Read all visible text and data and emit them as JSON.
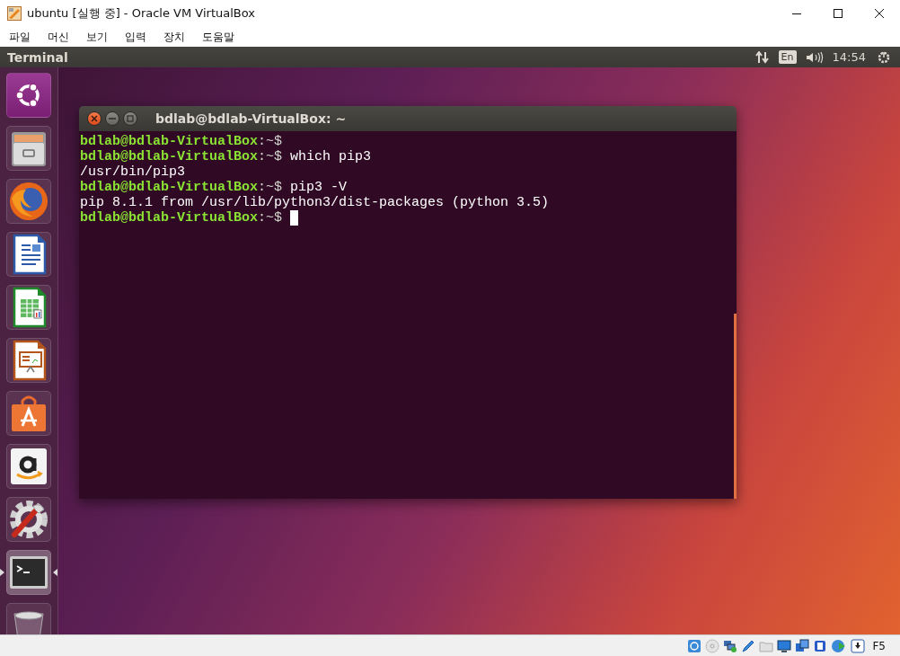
{
  "host_window": {
    "title": "ubuntu [실행 중] - Oracle VM VirtualBox"
  },
  "menu_bar": [
    "파일",
    "머신",
    "보기",
    "입력",
    "장치",
    "도움말"
  ],
  "top_panel": {
    "app_title": "Terminal",
    "keyboard_layout": "En",
    "clock": "14:54"
  },
  "launcher": [
    {
      "kind": "dash",
      "running": false,
      "focused": false
    },
    {
      "kind": "files",
      "running": false,
      "focused": false
    },
    {
      "kind": "browser",
      "running": false,
      "focused": false
    },
    {
      "kind": "writer",
      "running": false,
      "focused": false
    },
    {
      "kind": "calc",
      "running": false,
      "focused": false
    },
    {
      "kind": "impress",
      "running": false,
      "focused": false
    },
    {
      "kind": "software",
      "running": false,
      "focused": false
    },
    {
      "kind": "store",
      "running": false,
      "focused": false
    },
    {
      "kind": "settings",
      "running": false,
      "focused": false
    },
    {
      "kind": "terminal",
      "running": true,
      "focused": true
    },
    {
      "kind": "trash",
      "running": false,
      "focused": false
    }
  ],
  "terminal": {
    "title": "bdlab@bdlab-VirtualBox: ~",
    "lines": [
      {
        "kind": "prompt",
        "user_host": "bdlab@bdlab-VirtualBox",
        "path": ":~$",
        "cursor": false
      },
      {
        "kind": "prompt",
        "user_host": "bdlab@bdlab-VirtualBox",
        "path": ":~$",
        "command": "which pip3",
        "cursor": false
      },
      {
        "kind": "output",
        "text": "/usr/bin/pip3",
        "cursor": false
      },
      {
        "kind": "prompt",
        "user_host": "bdlab@bdlab-VirtualBox",
        "path": ":~$",
        "command": "pip3 -V",
        "cursor": false
      },
      {
        "kind": "output",
        "text": "pip 8.1.1 from /usr/lib/python3/dist-packages (python 3.5)",
        "cursor": false
      },
      {
        "kind": "prompt",
        "user_host": "bdlab@bdlab-VirtualBox",
        "path": ":~$",
        "cursor": true
      }
    ]
  },
  "status_bar": {
    "host_key": "F5"
  }
}
